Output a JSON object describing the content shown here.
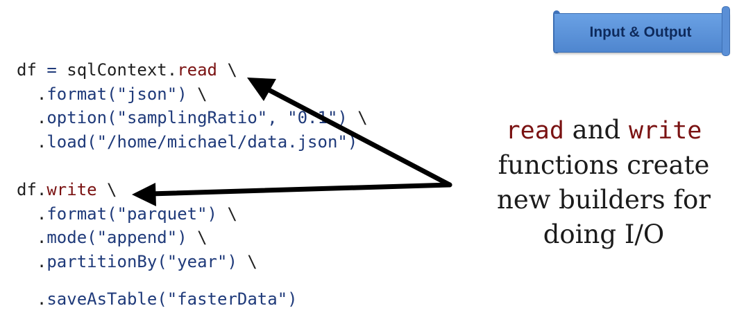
{
  "banner": {
    "label": "Input & Output"
  },
  "code": {
    "read_block": {
      "l1_a": "df ",
      "l1_eq": "=",
      "l1_b": " sqlContext.",
      "l1_read": "read",
      "l1_c": " \\",
      "l2_dot": "  .",
      "l2_fn": "format",
      "l2_args": "(\"json\")",
      "l2_tail": " \\",
      "l3_dot": "  .",
      "l3_fn": "option",
      "l3_args": "(\"samplingRatio\", \"0.1\")",
      "l3_tail": " \\",
      "l4_dot": "  .",
      "l4_fn": "load",
      "l4_args": "(\"/home/michael/data.json\")"
    },
    "write_block": {
      "l1_a": "df.",
      "l1_write": "write",
      "l1_c": " \\",
      "l2_dot": "  .",
      "l2_fn": "format",
      "l2_args": "(\"parquet\")",
      "l2_tail": " \\",
      "l3_dot": "  .",
      "l3_fn": "mode",
      "l3_args": "(\"append\")",
      "l3_tail": " \\",
      "l4_dot": "  .",
      "l4_fn": "partitionBy",
      "l4_args": "(\"year\")",
      "l4_tail": " \\",
      "l5_dot": "  .",
      "l5_fn": "saveAsTable",
      "l5_args": "(\"fasterData\")"
    }
  },
  "caption": {
    "read": "read",
    "and": " and ",
    "write": "write",
    "line2": "functions create",
    "line3": "new builders for",
    "line4": "doing I/O"
  },
  "colors": {
    "keyword": "#7a1212",
    "string": "#1f3a7a",
    "banner": "#5a8fd6",
    "arrow": "#000000"
  }
}
